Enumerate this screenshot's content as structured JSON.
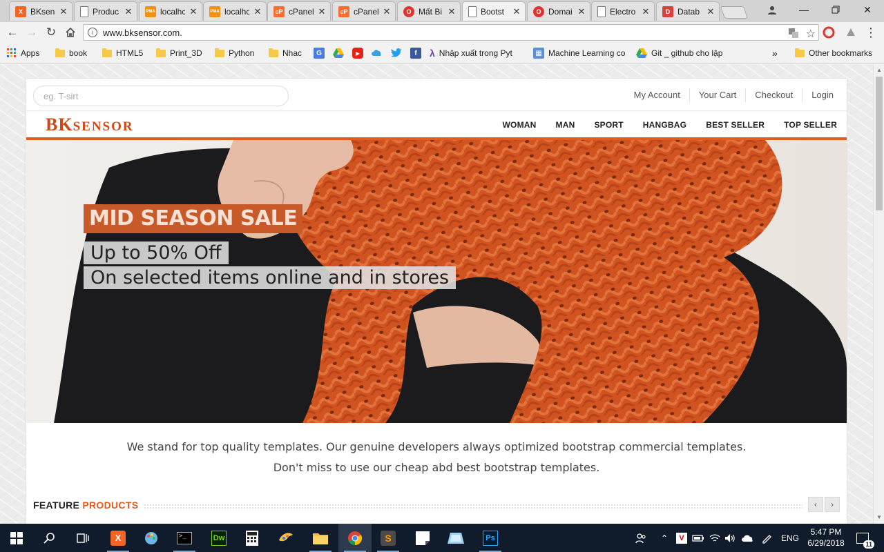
{
  "browser": {
    "tabs": [
      {
        "title": "BKsens",
        "icon": "xampp-icon",
        "color": "#f26522",
        "glyph": "X"
      },
      {
        "title": "Produc",
        "icon": "page-icon",
        "color": "#ffffff",
        "glyph": ""
      },
      {
        "title": "localhc",
        "icon": "phpmyadmin-icon",
        "color": "#f29111",
        "glyph": "PMA"
      },
      {
        "title": "localhc",
        "icon": "phpmyadmin-icon",
        "color": "#f29111",
        "glyph": "PMA"
      },
      {
        "title": "cPanel",
        "icon": "cpanel-icon",
        "color": "#ff6c2c",
        "glyph": "cP"
      },
      {
        "title": "cPanel",
        "icon": "cpanel-icon",
        "color": "#ff6c2c",
        "glyph": "cP"
      },
      {
        "title": "Mất Bi",
        "icon": "opera-icon",
        "color": "#e0342f",
        "glyph": "O"
      },
      {
        "title": "Bootst",
        "icon": "page-icon",
        "color": "#ffffff",
        "glyph": ""
      },
      {
        "title": "Domai",
        "icon": "opera-icon",
        "color": "#e0342f",
        "glyph": "O"
      },
      {
        "title": "Electro",
        "icon": "page-icon",
        "color": "#ffffff",
        "glyph": ""
      },
      {
        "title": "Datab",
        "icon": "database-icon",
        "color": "#d8423a",
        "glyph": "D"
      }
    ],
    "active_tab": 7,
    "url": "www.bksensor.com."
  },
  "bookmarks": [
    {
      "label": "Apps",
      "type": "apps"
    },
    {
      "label": "book",
      "type": "folder"
    },
    {
      "label": "HTML5",
      "type": "folder"
    },
    {
      "label": "Print_3D",
      "type": "folder"
    },
    {
      "label": "Python",
      "type": "folder"
    },
    {
      "label": "Nhac",
      "type": "folder"
    },
    {
      "label": "",
      "type": "translate-icon"
    },
    {
      "label": "",
      "type": "drive-icon"
    },
    {
      "label": "",
      "type": "youtube-icon"
    },
    {
      "label": "",
      "type": "onedrive-icon"
    },
    {
      "label": "",
      "type": "twitter-icon"
    },
    {
      "label": "",
      "type": "facebook-icon"
    },
    {
      "label": "Nhập xuất trong Pyt",
      "type": "site"
    },
    {
      "label": "Machine Learning co",
      "type": "site"
    },
    {
      "label": "Git _ github cho lập",
      "type": "drive"
    },
    {
      "label": "»",
      "type": "more"
    },
    {
      "label": "Other bookmarks",
      "type": "folder"
    }
  ],
  "site": {
    "search_placeholder": "eg. T-sirt",
    "account_links": [
      "My Account",
      "Your Cart",
      "Checkout",
      "Login"
    ],
    "logo_big": "BK",
    "logo_small": "SENSOR",
    "menu": [
      "WOMAN",
      "MAN",
      "SPORT",
      "HANGBAG",
      "BEST SELLER",
      "TOP SELLER"
    ],
    "hero": {
      "headline": "MID SEASON SALE",
      "line1": "Up to 50% Off",
      "line2": "On selected items online and in stores"
    },
    "intro_line1": "We stand for top quality templates. Our genuine developers always optimized bootstrap commercial templates.",
    "intro_line2": "Don't miss to use our cheap abd best bootstrap templates.",
    "feature_word1": "FEATURE",
    "feature_word2": "PRODUCTS",
    "prev": "‹",
    "next": "›"
  },
  "taskbar": {
    "apps": [
      "start-icon",
      "search-icon",
      "task-view-icon",
      "xampp-icon",
      "paint-icon",
      "terminal-icon",
      "dreamweaver-icon",
      "calculator-icon",
      "paint-3d-icon",
      "file-explorer-icon",
      "chrome-icon",
      "sublime-icon",
      "sticky-notes-icon",
      "folder-app-icon",
      "photoshop-icon"
    ],
    "language": "ENG",
    "time": "5:47 PM",
    "date": "6/29/2018",
    "notifications": "11"
  },
  "colors": {
    "accent": "#e25b1f",
    "logo": "#d0471a",
    "taskbar": "#101c2b"
  }
}
